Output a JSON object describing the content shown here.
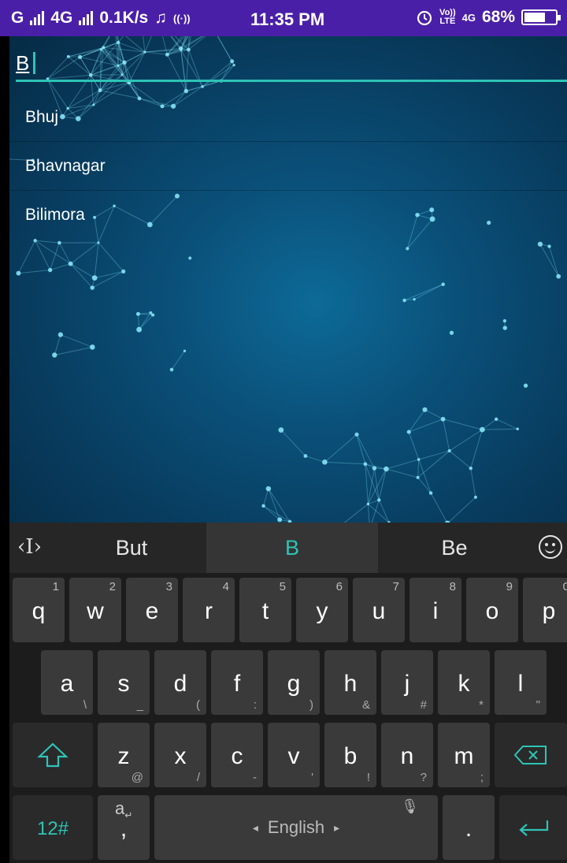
{
  "status_bar": {
    "left_carrier": "G",
    "network_type": "4G",
    "speed": "0.1K/s",
    "time": "11:35 PM",
    "volte": "Vo))",
    "lte": "LTE",
    "network_right": "4G",
    "battery_percent": "68%",
    "battery_level": 0.68
  },
  "search": {
    "value": "B"
  },
  "suggestions": [
    "Bhuj",
    "Bhavnagar",
    "Bilimora"
  ],
  "keyboard": {
    "suggestions": [
      "But",
      "B",
      "Be"
    ],
    "row1": [
      {
        "k": "q",
        "s": "1"
      },
      {
        "k": "w",
        "s": "2"
      },
      {
        "k": "e",
        "s": "3"
      },
      {
        "k": "r",
        "s": "4"
      },
      {
        "k": "t",
        "s": "5"
      },
      {
        "k": "y",
        "s": "6"
      },
      {
        "k": "u",
        "s": "7"
      },
      {
        "k": "i",
        "s": "8"
      },
      {
        "k": "o",
        "s": "9"
      },
      {
        "k": "p",
        "s": "0"
      }
    ],
    "row2": [
      {
        "k": "a",
        "s": "\\"
      },
      {
        "k": "s",
        "s": "_"
      },
      {
        "k": "d",
        "s": "("
      },
      {
        "k": "f",
        "s": ":"
      },
      {
        "k": "g",
        "s": ")"
      },
      {
        "k": "h",
        "s": "&"
      },
      {
        "k": "j",
        "s": "#"
      },
      {
        "k": "k",
        "s": "*"
      },
      {
        "k": "l",
        "s": "\""
      }
    ],
    "row3": [
      {
        "k": "z",
        "s": "@"
      },
      {
        "k": "x",
        "s": "/"
      },
      {
        "k": "c",
        "s": "-"
      },
      {
        "k": "v",
        "s": "'"
      },
      {
        "k": "b",
        "s": "!"
      },
      {
        "k": "n",
        "s": "?"
      },
      {
        "k": "m",
        "s": ";"
      }
    ],
    "symbols_label": "12#",
    "comma_label": ",",
    "space_label": "English",
    "space_left_arrow": "◂",
    "space_right_arrow": "▸",
    "period_label": "."
  },
  "colors": {
    "status_bar": "#4a1fa8",
    "accent": "#2ec4b6",
    "key_bg": "#3a3a3a",
    "keyboard_bg": "#1c1c1c"
  },
  "icons": [
    "shift-icon",
    "backspace-icon",
    "enter-icon",
    "mic-icon",
    "emoji-icon",
    "cursor-tool-icon",
    "handwriting-icon",
    "alarm-icon"
  ]
}
